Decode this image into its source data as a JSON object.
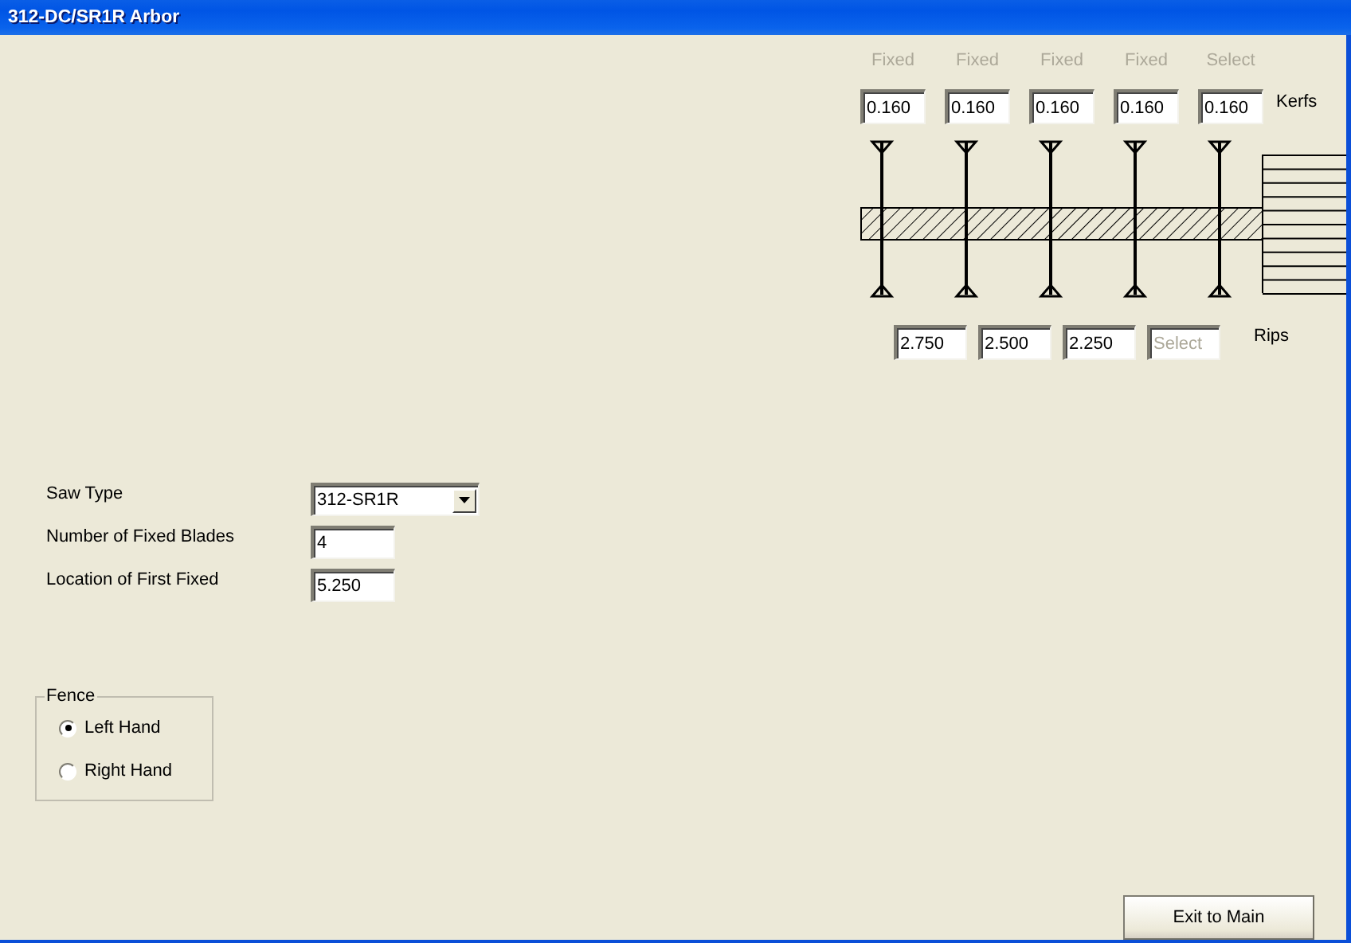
{
  "window": {
    "title": "312-DC/SR1R Arbor"
  },
  "kerfs": {
    "label": "Kerfs",
    "blades": [
      {
        "label": "Fixed",
        "disabled": true,
        "value": "0.160"
      },
      {
        "label": "Fixed",
        "disabled": true,
        "value": "0.160"
      },
      {
        "label": "Fixed",
        "disabled": true,
        "value": "0.160"
      },
      {
        "label": "Fixed",
        "disabled": true,
        "value": "0.160"
      },
      {
        "label": "Select",
        "disabled": true,
        "value": "0.160"
      }
    ]
  },
  "rips": {
    "label": "Rips",
    "fields": [
      {
        "value": "2.750"
      },
      {
        "value": "2.500"
      },
      {
        "value": "2.250"
      },
      {
        "placeholder": "Select"
      }
    ]
  },
  "form": [
    {
      "kind": "dropdown",
      "label": "Saw Type",
      "value": "312-SR1R"
    },
    {
      "kind": "field",
      "label": "Number of Fixed Blades",
      "value": "4"
    },
    {
      "kind": "field",
      "label": "Location of First Fixed",
      "value": "5.250"
    }
  ],
  "fence": {
    "title": "Fence",
    "options": [
      {
        "label": "Left Hand",
        "selected": true
      },
      {
        "label": "Right Hand",
        "selected": false
      }
    ]
  },
  "buttons": [
    "Exit to Main"
  ]
}
